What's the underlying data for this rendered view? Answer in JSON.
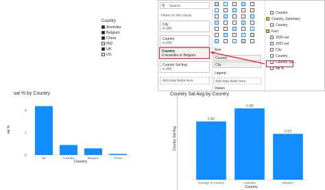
{
  "slicer": {
    "title": "Country",
    "items": [
      {
        "label": "Australia",
        "checked": true
      },
      {
        "label": "Belgium",
        "checked": true
      },
      {
        "label": "China",
        "checked": true
      },
      {
        "label": "IND",
        "checked": false
      },
      {
        "label": "UK",
        "checked": true
      },
      {
        "label": "US",
        "checked": false
      }
    ]
  },
  "filter_pane": {
    "search_placeholder": "Search",
    "section": "Filters on this visual",
    "filters": [
      {
        "name": "City",
        "value": "is (All)"
      },
      {
        "name": "Country",
        "value": "is (All)"
      },
      {
        "name": "Country",
        "value": "is Australia or Belgium"
      },
      {
        "name": "Country Sal Avg",
        "value": "is (All)"
      }
    ],
    "add_label": "Add data fields here"
  },
  "build_pane": {
    "axis_label": "Axis",
    "axis_fields": [
      "Country",
      "City"
    ],
    "legend_label": "Legend",
    "legend_add": "Add data fields here",
    "values_label": "Values"
  },
  "fields_pane": {
    "items": [
      {
        "label": "Country",
        "depth": 1
      },
      {
        "label": "Country_Summary",
        "depth": 0
      },
      {
        "label": "Country",
        "depth": 1
      },
      {
        "label": "Fact",
        "depth": 0
      },
      {
        "label": "2020 sal",
        "depth": 1
      },
      {
        "label": "2021 sal",
        "depth": 1
      },
      {
        "label": "City",
        "depth": 1
      },
      {
        "label": "Country",
        "depth": 1
      },
      {
        "label": "Country Sal...",
        "depth": 1
      },
      {
        "label": "sal %",
        "depth": 1
      }
    ]
  },
  "chart_left": {
    "title": "sal % by Country",
    "ylabel": "sal %",
    "xlabel": "Country",
    "yticks": [
      "4",
      "2",
      "0"
    ]
  },
  "chart_right": {
    "title": "Country Sal Avg by Country",
    "ylabel": "Country Sal Avg",
    "xlabel": "Country"
  },
  "chart_data": [
    {
      "type": "bar",
      "title": "sal % by Country",
      "xlabel": "Country",
      "ylabel": "sal %",
      "categories": [
        "UK",
        "Australia",
        "Belgium",
        "China"
      ],
      "values": [
        4.4,
        0.9,
        0.6,
        0.1
      ],
      "ylim": [
        0,
        5
      ],
      "color": "#118dff"
    },
    {
      "type": "bar",
      "title": "Country Sal Avg by Country",
      "xlabel": "Country",
      "ylabel": "Country Sal Avg",
      "categories": [
        "Average of Country",
        "Australia",
        "Belgium"
      ],
      "values": [
        0.8,
        0.98,
        0.63
      ],
      "data_labels": [
        "0.80",
        "0.98",
        "0.63"
      ],
      "ylim": [
        0,
        1.15
      ],
      "color": "#118dff"
    }
  ],
  "colors": {
    "bar": "#118dff",
    "highlight": "#e81123",
    "panel_border": "#c8c6c4",
    "field_icon": "#f2c811"
  }
}
